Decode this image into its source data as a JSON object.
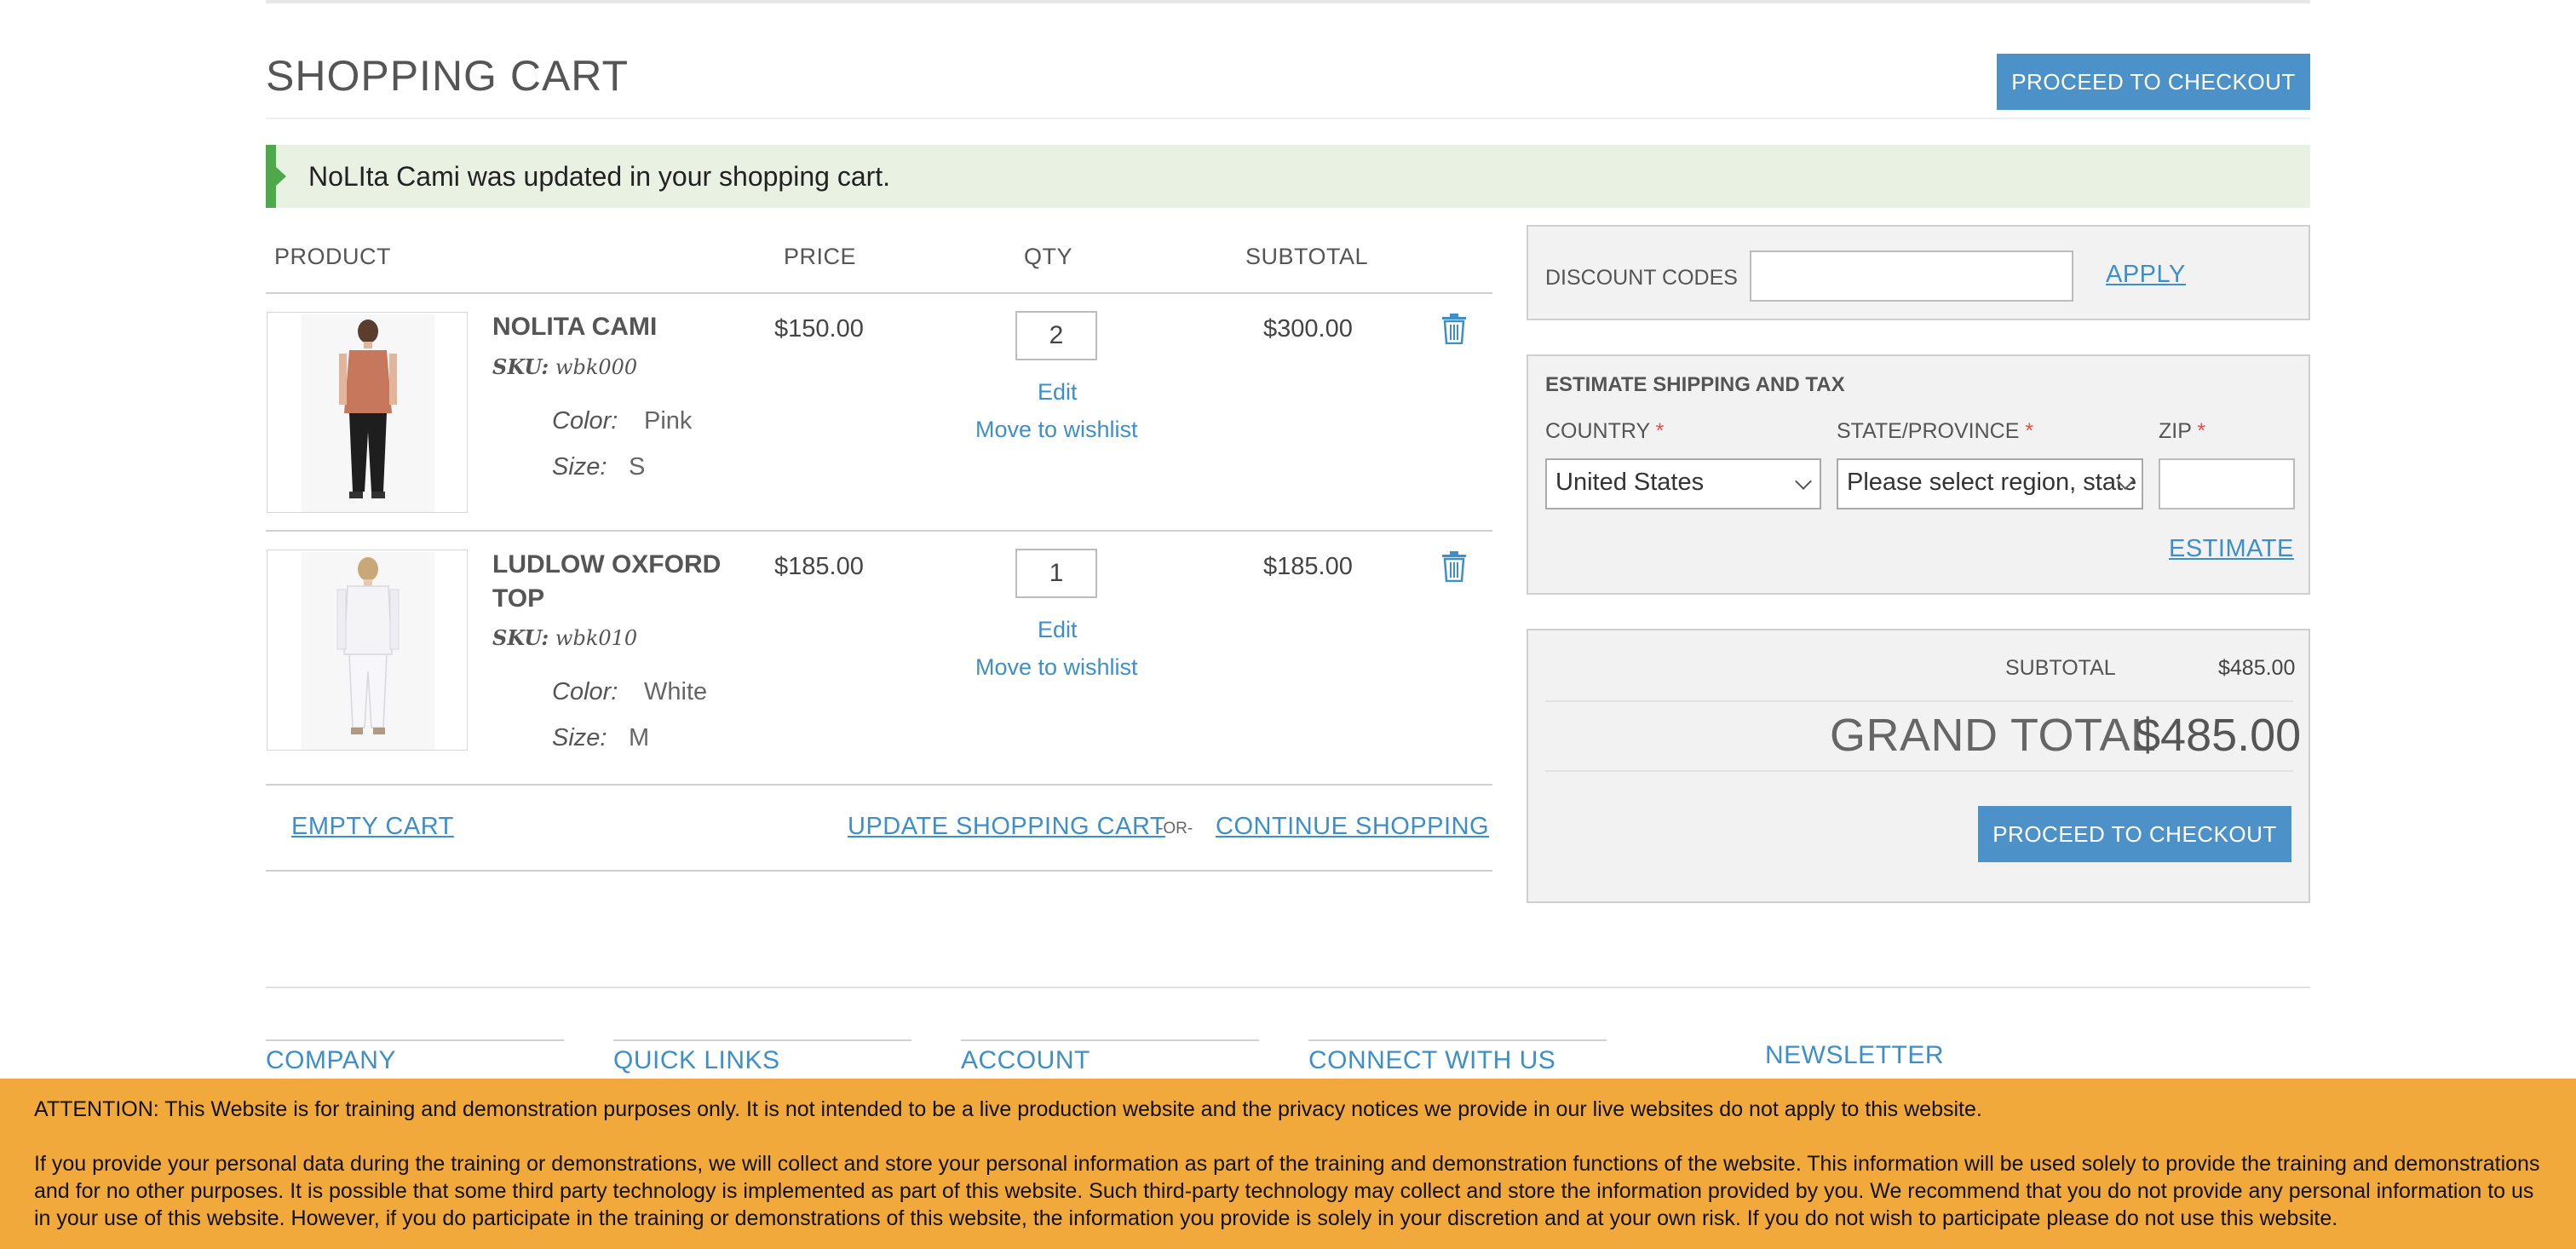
{
  "page": {
    "title": "SHOPPING CART",
    "checkout_top_label": "PROCEED TO CHECKOUT"
  },
  "notice": {
    "text": "NoLIta Cami was updated in your shopping cart."
  },
  "table": {
    "headers": [
      "PRODUCT",
      "PRICE",
      "QTY",
      "SUBTOTAL"
    ],
    "items": [
      {
        "name": "NOLITA CAMI",
        "sku_label": "SKU:",
        "sku": "wbk000",
        "options": [
          {
            "label": "Color:",
            "value": "Pink"
          },
          {
            "label": "Size:",
            "value": "S"
          }
        ],
        "price": "$150.00",
        "qty": "2",
        "subtotal": "$300.00",
        "edit_label": "Edit",
        "wishlist_label": "Move to wishlist"
      },
      {
        "name_line1": "LUDLOW OXFORD",
        "name_line2": "TOP",
        "sku_label": "SKU:",
        "sku": "wbk010",
        "options": [
          {
            "label": "Color:",
            "value": "White"
          },
          {
            "label": "Size:",
            "value": "M"
          }
        ],
        "price": "$185.00",
        "qty": "1",
        "subtotal": "$185.00",
        "edit_label": "Edit",
        "wishlist_label": "Move to wishlist"
      }
    ]
  },
  "actions": {
    "empty_cart": "EMPTY CART",
    "update_cart": "UPDATE SHOPPING CART",
    "or": "-OR-",
    "continue_shopping": "CONTINUE SHOPPING"
  },
  "discount": {
    "label": "DISCOUNT CODES",
    "value": "",
    "apply_label": "APPLY"
  },
  "shipping": {
    "heading": "ESTIMATE SHIPPING AND TAX",
    "country_label": "COUNTRY",
    "country_value": "United States",
    "state_label": "STATE/PROVINCE",
    "state_value": "Please select region, state or province",
    "zip_label": "ZIP",
    "required_mark": "*",
    "zip_value": "",
    "estimate_label": "ESTIMATE"
  },
  "totals": {
    "subtotal_label": "SUBTOTAL",
    "subtotal_value": "$485.00",
    "grand_total_label": "GRAND TOTAL",
    "grand_total_value": "$485.00",
    "checkout_label": "PROCEED TO CHECKOUT"
  },
  "footer": {
    "columns": [
      "COMPANY",
      "QUICK LINKS",
      "ACCOUNT",
      "CONNECT WITH US",
      "NEWSLETTER"
    ]
  },
  "attention": {
    "line1": "ATTENTION: This Website is for training and demonstration purposes only. It is not intended to be a live production website and the privacy notices we provide in our live websites do not apply to this website.",
    "line2": "If you provide your personal data during the training or demonstrations, we will collect and store your personal information as part of the training and demonstration functions of the website. This information will be used solely to provide the training and demonstrations and for no other purposes. It is possible that some third party technology is implemented as part of this website. Such third-party technology may collect and store the information provided by you. We recommend that you do not provide any personal information to us in your use of this website. However, if you do participate in the training or demonstrations of this website, the information you provide is solely in your discretion and at your own risk. If you do not wish to participate please do not use this website."
  },
  "colors": {
    "accent": "#4c92c9",
    "link": "#3d8fc9",
    "success_bar": "#4ea84c",
    "success_bg": "#e8f1e2",
    "attention_bg": "#f2a93b"
  },
  "icons": {
    "delete": "trash-icon",
    "notice": "success-arrow-icon",
    "select": "chevron-down-icon"
  }
}
